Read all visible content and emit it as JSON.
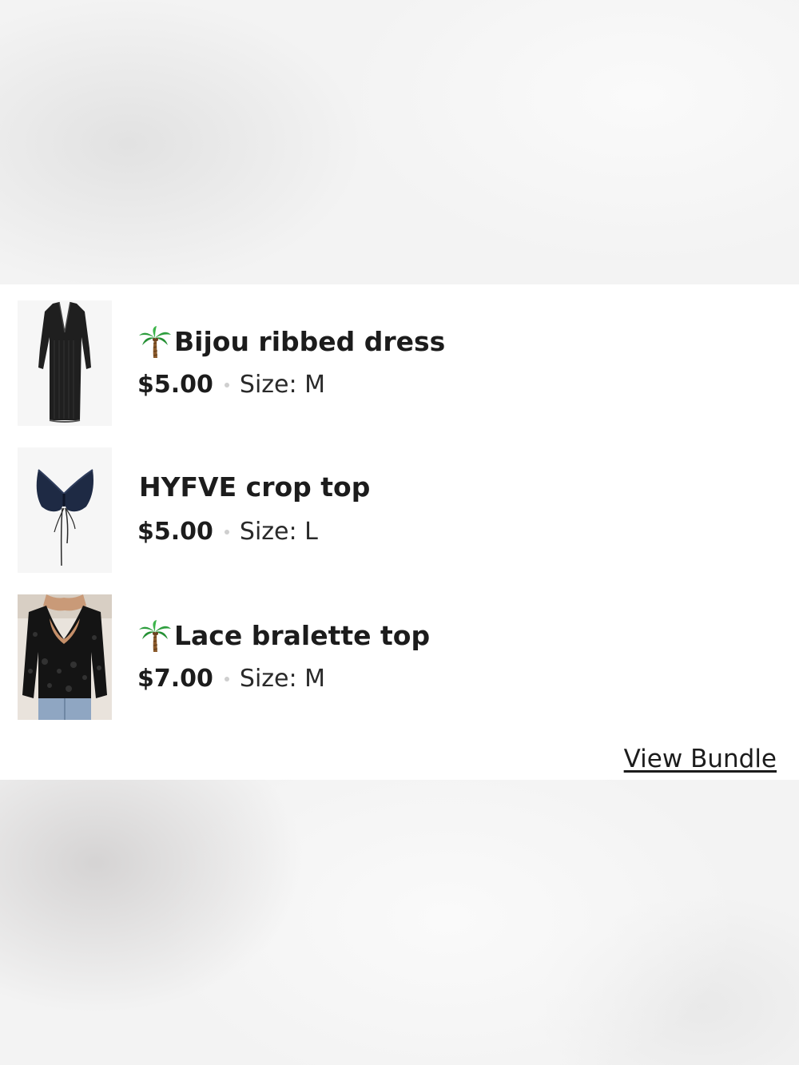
{
  "bundle": {
    "items": [
      {
        "thumbnail": "black ribbed maxi dress",
        "icon": "palm-tree-icon",
        "title": "Bijou ribbed dress",
        "price": "$5.00",
        "size": "Size: M"
      },
      {
        "thumbnail": "navy ruched crop top",
        "icon": null,
        "title": "HYFVE crop top",
        "price": "$5.00",
        "size": "Size: L"
      },
      {
        "thumbnail": "black lace bralette top",
        "icon": "palm-tree-icon",
        "title": "Lace bralette top",
        "price": "$7.00",
        "size": "Size: M"
      }
    ],
    "view_bundle_label": "View Bundle"
  },
  "colors": {
    "text": "#1c1c1c",
    "panel": "#ffffff",
    "separator_dot": "#cfcfcf"
  }
}
